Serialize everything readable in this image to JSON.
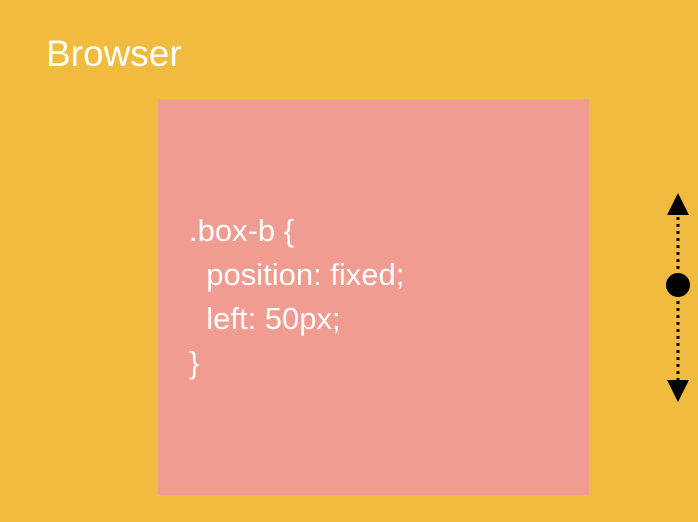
{
  "viewport": {
    "label": "Browser",
    "background_color": "#F0BB3E"
  },
  "box": {
    "background_color": "#F09C90",
    "code_lines": [
      ".box-b {",
      "  position: fixed;",
      "  left: 50px;",
      "}"
    ]
  },
  "scroll_indicator": {
    "icon": "vertical-scroll-arrows-icon",
    "color": "#000000"
  }
}
